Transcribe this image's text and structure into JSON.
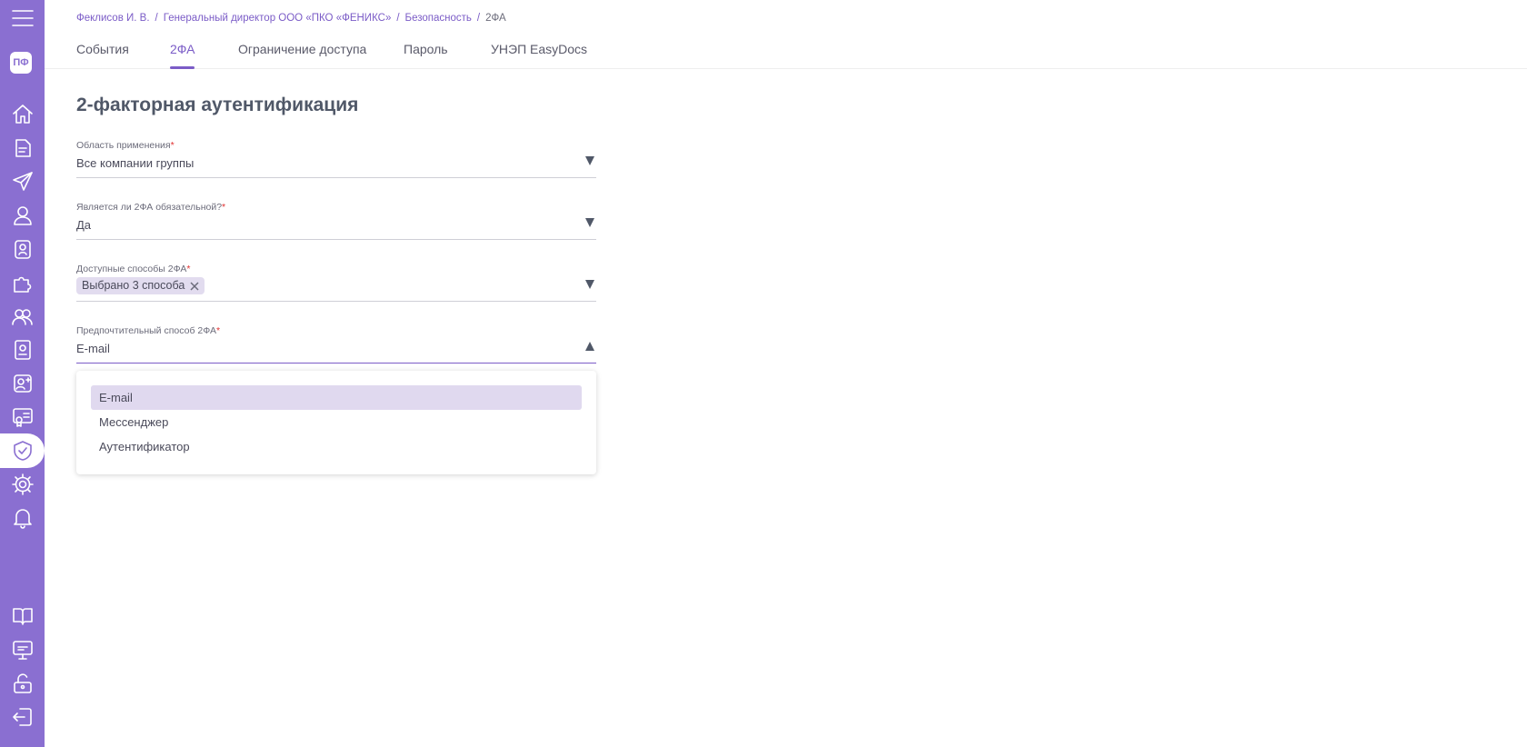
{
  "sidebar": {
    "avatar": "ПФ",
    "colors": {
      "bg": "#8a6fd1",
      "active": "#ffffff"
    },
    "icons": [
      "menu-icon",
      "home-icon",
      "document-icon",
      "send-icon",
      "user-icon",
      "badge-icon",
      "puzzle-icon",
      "users-icon",
      "book-user-icon",
      "contact-plus-icon",
      "certificate-icon",
      "shield-check-icon",
      "gear-icon",
      "bell-icon",
      "book-open-icon",
      "monitor-chat-icon",
      "unlock-icon",
      "logout-icon"
    ]
  },
  "breadcrumb": {
    "items": [
      "Феклисов И. В.",
      "Генеральный директор ООО «ПКО «ФЕНИКС»",
      "Безопасность"
    ],
    "current": "2ФА",
    "separator": "/"
  },
  "tabs": [
    {
      "label": "События",
      "active": false
    },
    {
      "label": "2ФА",
      "active": true
    },
    {
      "label": "Ограничение доступа",
      "active": false
    },
    {
      "label": "Пароль",
      "active": false
    },
    {
      "label": "УНЭП EasyDocs",
      "active": false
    }
  ],
  "page": {
    "title": "2-факторная аутентификация"
  },
  "form": {
    "scope": {
      "label": "Область применения",
      "required_mark": "*",
      "value": "Все компании группы"
    },
    "mandatory": {
      "label": "Является ли 2ФА обязательной?",
      "required_mark": "*",
      "value": "Да"
    },
    "methods": {
      "label": "Доступные способы 2ФА",
      "required_mark": "*",
      "chip": "Выбрано 3 способа"
    },
    "preferred": {
      "label": "Предпочтительный способ 2ФА",
      "required_mark": "*",
      "value": "E-mail",
      "options": [
        "E-mail",
        "Мессенджер",
        "Аутентификатор"
      ],
      "selected_index": 0
    }
  },
  "colors": {
    "accent": "#7b5cc7",
    "required": "#e03030",
    "selected_option_bg": "#e0d9ef"
  }
}
